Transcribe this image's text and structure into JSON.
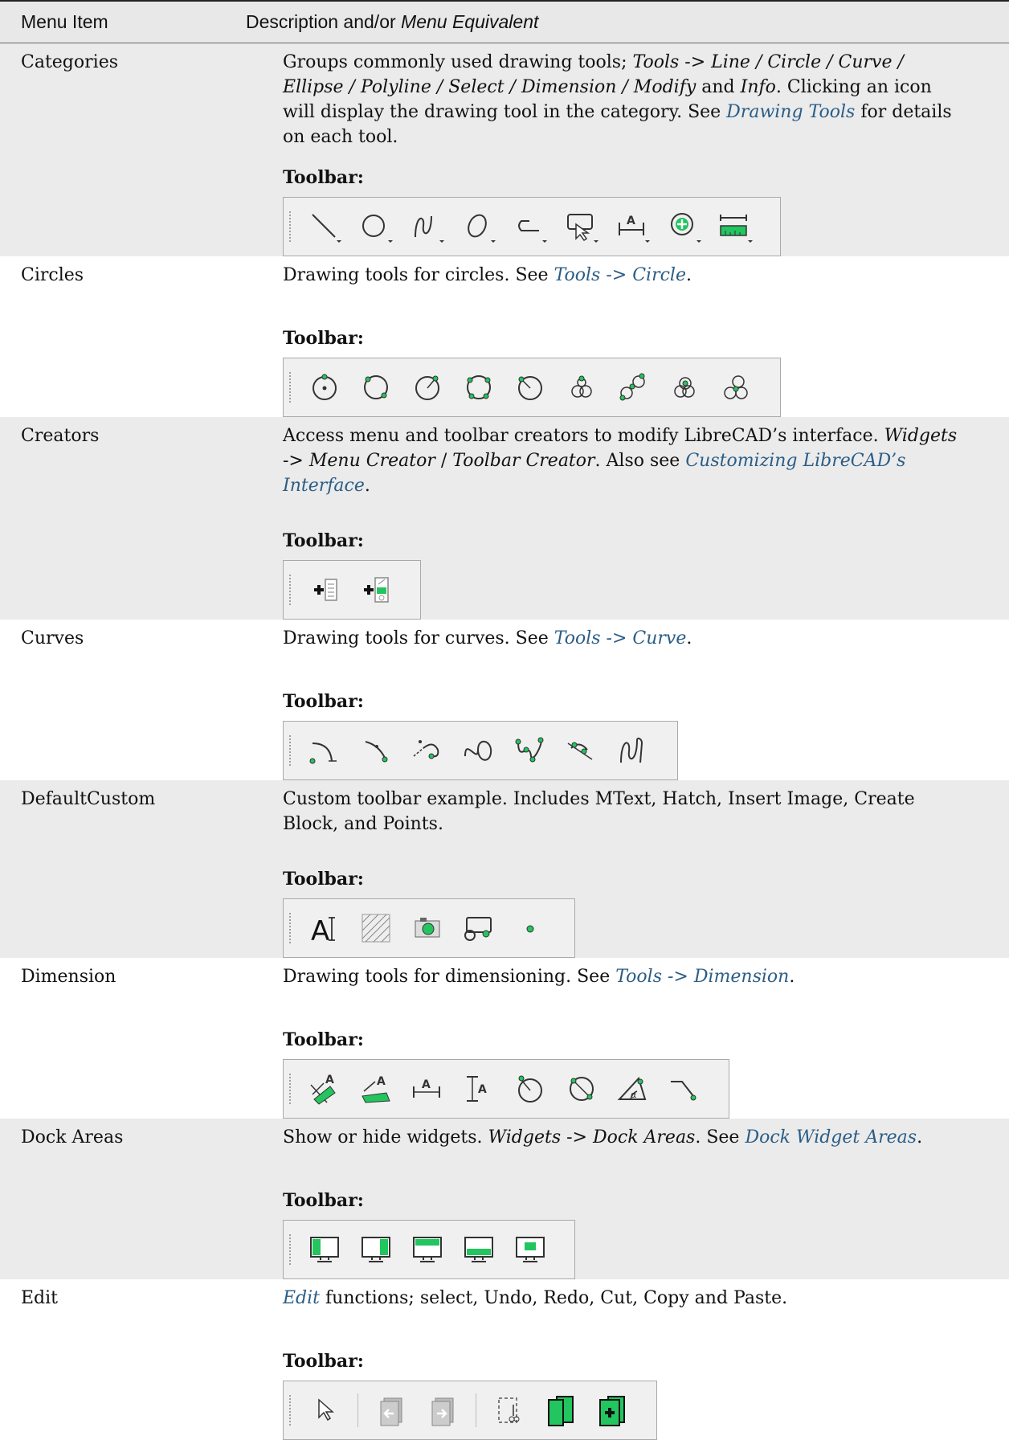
{
  "header": {
    "col1": "Menu Item",
    "col2_plain": "Description and/or ",
    "col2_italic": "Menu Equivalent"
  },
  "toolbar_label": "Toolbar:",
  "rows": {
    "categories": {
      "name": "Categories",
      "t1": "Groups commonly used drawing tools; ",
      "t2": "Tools -> Line / Circle / Curve / Ellipse / Polyline / Select / Dimension / Modify",
      "t3": " and ",
      "t4": "Info",
      "t5": ". Clicking an icon will display the drawing tool in the category. See ",
      "link": "Drawing Tools",
      "t6": " for details on each tool."
    },
    "circles": {
      "name": "Circles",
      "t1": "Drawing tools for circles. See ",
      "link": "Tools -> Circle",
      "t2": "."
    },
    "creators": {
      "name": "Creators",
      "t1": "Access menu and toolbar creators to modify LibreCAD’s interface. ",
      "t2": "Widgets",
      "t3": " -> ",
      "t4": "Menu Creator",
      "t5": " / ",
      "t6": "Toolbar Creator",
      "t7": ". Also see ",
      "link": "Customizing LibreCAD’s Interface",
      "t8": "."
    },
    "curves": {
      "name": "Curves",
      "t1": "Drawing tools for curves. See ",
      "link": "Tools -> Curve",
      "t2": "."
    },
    "defaultcustom": {
      "name": "DefaultCustom",
      "t1": "Custom toolbar example. Includes MText, Hatch, Insert Image, Create Block, and Points."
    },
    "dimension": {
      "name": "Dimension",
      "t1": "Drawing tools for dimensioning. See ",
      "link": "Tools -> Dimension",
      "t2": "."
    },
    "dockareas": {
      "name": "Dock Areas",
      "t1": "Show or hide widgets. ",
      "t2": "Widgets",
      "t3": " -> ",
      "t4": "Dock Areas",
      "t5": ". See ",
      "link": "Dock Widget Areas",
      "t6": "."
    },
    "edit": {
      "name": "Edit",
      "link": "Edit",
      "t1": " functions; select, Undo, Redo, Cut, Copy and Paste."
    }
  },
  "icons": {
    "categories": [
      "line-icon",
      "circle-icon",
      "curve-icon",
      "ellipse-icon",
      "polyline-icon",
      "select-icon",
      "dimension-icon",
      "modify-icon",
      "info-icon"
    ],
    "circles": [
      "circle-center-point-icon",
      "circle-two-points-icon",
      "circle-center-radius-icon",
      "circle-three-points-icon",
      "circle-radius-icon",
      "circle-tangent-two-icon",
      "circle-tangent-three-icon",
      "circle-concentric-icon",
      "circle-inscribed-icon"
    ],
    "creators": [
      "menu-creator-icon",
      "toolbar-creator-icon"
    ],
    "curves": [
      "arc-center-icon",
      "arc-three-points-icon",
      "arc-tangent-icon",
      "spline-icon",
      "spline-through-points-icon",
      "arc-concentric-icon",
      "freehand-curve-icon"
    ],
    "defaultcustom": [
      "mtext-icon",
      "hatch-icon",
      "insert-image-icon",
      "create-block-icon",
      "point-icon"
    ],
    "dimension": [
      "dimension-aligned-icon",
      "dimension-linear-icon",
      "dimension-horizontal-icon",
      "dimension-vertical-icon",
      "dimension-radial-icon",
      "dimension-diametric-icon",
      "dimension-angular-icon",
      "dimension-leader-icon"
    ],
    "dockareas": [
      "dock-left-icon",
      "dock-right-icon",
      "dock-top-icon",
      "dock-bottom-icon",
      "dock-floating-icon"
    ],
    "edit": [
      "select-pointer-icon",
      "undo-icon",
      "redo-icon",
      "cut-icon",
      "copy-icon",
      "paste-icon"
    ]
  },
  "colors": {
    "accent_green": "#22c55e",
    "link": "#2a5d86"
  }
}
